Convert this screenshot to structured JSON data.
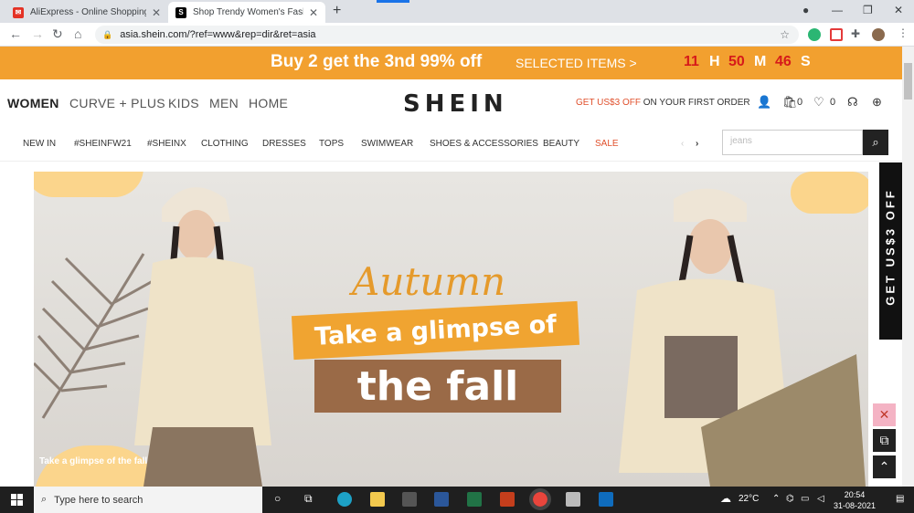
{
  "browser": {
    "tabs": [
      {
        "title": "AliExpress - Online Shopping for",
        "favicon": "aliexpress-icon",
        "active": false
      },
      {
        "title": "Shop Trendy Women's Fashion |",
        "favicon": "shein-s-icon",
        "active": true
      }
    ],
    "url": "asia.shein.com/?ref=www&rep=dir&ret=asia"
  },
  "promo": {
    "headline": "Buy 2 get the 3nd 99% off",
    "selected": "SELECTED ITEMS >",
    "countdown": {
      "hours": "11",
      "h_label": "H",
      "minutes": "50",
      "m_label": "M",
      "seconds": "46",
      "s_label": "S"
    }
  },
  "header": {
    "categories": [
      "WOMEN",
      "CURVE + PLUS",
      "KIDS",
      "MEN",
      "HOME"
    ],
    "logo": "SHEIN",
    "offer_red": "GET US$3 OFF",
    "offer_rest": " ON YOUR FIRST ORDER",
    "bag_count": "0",
    "wishlist_count": "0"
  },
  "subnav": {
    "items": [
      "NEW IN",
      "#SHEINFW21",
      "#SHEINX",
      "CLOTHING",
      "DRESSES",
      "TOPS",
      "SWIMWEAR",
      "SHOES & ACCESSORIES",
      "BEAUTY",
      "SALE"
    ],
    "search_placeholder": "jeans"
  },
  "banner": {
    "script": "Autumn",
    "line1": "Take a glimpse of",
    "line2": "the fall",
    "caption": "Take a glimpse of the fall"
  },
  "sidetab": {
    "label": "GET US$3 OFF"
  },
  "taskbar": {
    "search_placeholder": "Type here to search",
    "temperature": "22°C",
    "time": "20:54",
    "date": "31-08-2021"
  },
  "colors": {
    "promo": "#f2a02f",
    "countdown": "#d61a1a",
    "sale": "#e0502c"
  }
}
